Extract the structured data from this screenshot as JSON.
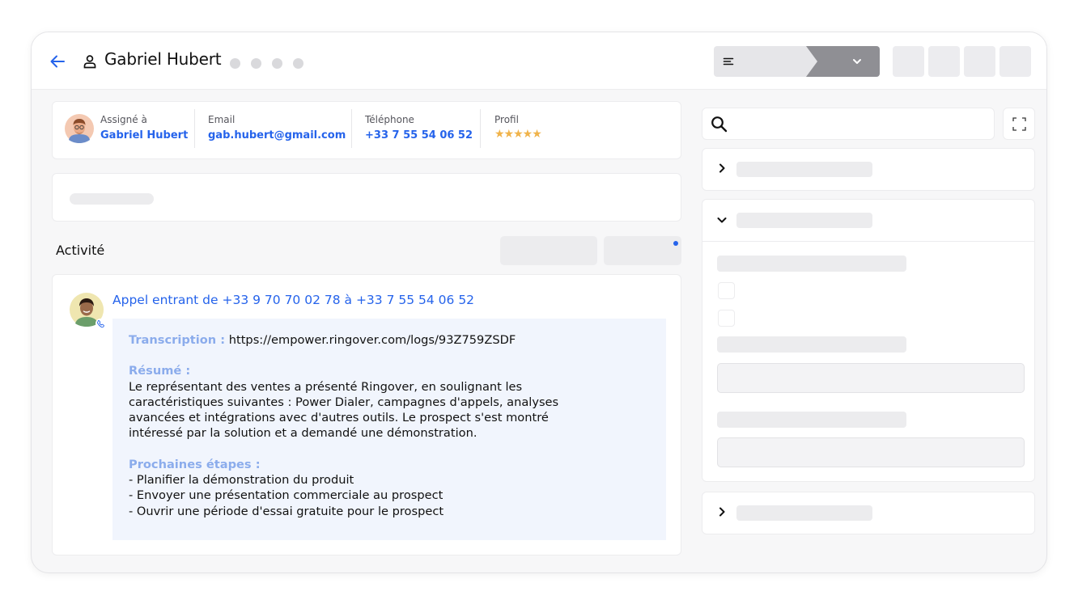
{
  "header": {
    "contact_name": "Gabriel Hubert"
  },
  "contact_info": {
    "assigned_label": "Assigné à",
    "assigned_value": "Gabriel Hubert",
    "email_label": "Email",
    "email_value": "gab.hubert@gmail.com",
    "phone_label": "Téléphone",
    "phone_value": "+33 7 55 54 06 52",
    "profile_label": "Profil",
    "profile_rating": 5,
    "profile_stars": "★★★★★"
  },
  "activity": {
    "section_title": "Activité",
    "call_title": "Appel entrant de +33 9 70 70 02 78 à +33 7 55 54 06 52",
    "transcription_label": "Transcription :",
    "transcription_link": "https://empower.ringover.com/logs/93Z759ZSDF",
    "summary_label": "Résumé :",
    "summary_lines": [
      "Le représentant des ventes a présenté Ringover, en soulignant les",
      "caractéristiques suivantes : Power Dialer, campagnes d'appels, analyses",
      "avancées et intégrations avec d'autres outils. Le prospect s'est montré",
      "intéressé par la solution et a demandé une démonstration."
    ],
    "next_steps_label": "Prochaines étapes :",
    "next_steps": [
      "- Planifier la démonstration du produit",
      "- Envoyer une présentation commerciale au prospect",
      "- Ouvrir une période d'essai gratuite pour le prospect"
    ]
  },
  "colors": {
    "accent": "#2563eb",
    "star": "#f0b34a",
    "label_blue": "#8bacec",
    "transcript_bg": "#f1f5fd"
  },
  "icons": {
    "back": "arrow-left-icon",
    "person": "person-icon",
    "menu": "menu-lines-icon",
    "chevron": "chevron-down-icon",
    "search": "search-icon",
    "expand": "fullscreen-icon",
    "phone": "phone-icon"
  }
}
